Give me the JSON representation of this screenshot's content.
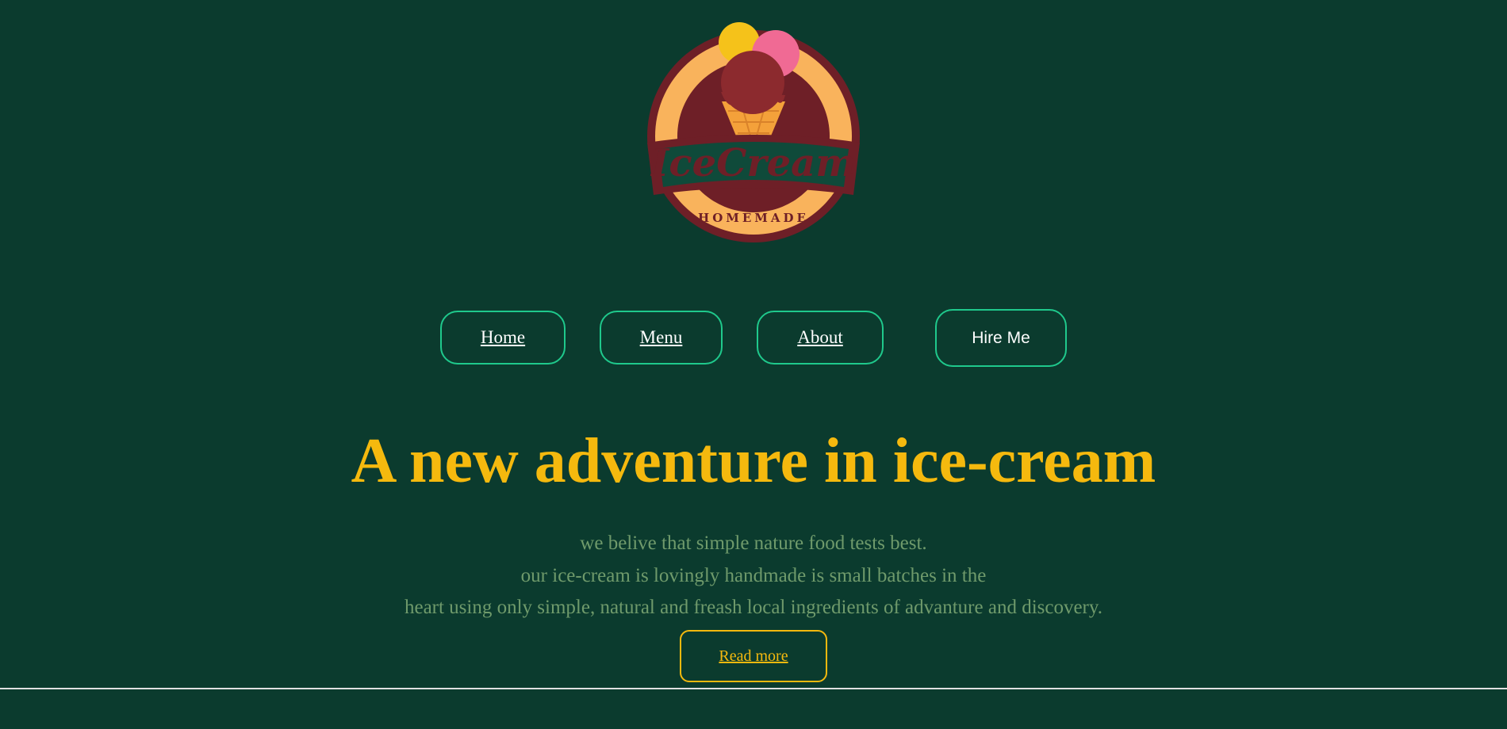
{
  "logo": {
    "brand_text": "IceCream",
    "sub_text": "HOMEMADE"
  },
  "nav": {
    "home_label": "Home",
    "menu_label": "Menu",
    "about_label": "About",
    "hire_label": "Hire Me"
  },
  "hero": {
    "headline": "A new adventure in ice-cream",
    "description_lines": [
      "we belive that simple nature food tests best.",
      "our ice-cream is lovingly handmade is small batches in the",
      "heart using only simple, natural and freash local ingredients of advanture and discovery."
    ],
    "read_more_label": "Read more"
  },
  "colors": {
    "background": "#0b3b2e",
    "accent_green": "#1fc98c",
    "headline_yellow": "#f5b90e",
    "description_text": "#6f9a6b",
    "logo_maroon": "#6e1f27",
    "logo_peach": "#f9b35c"
  }
}
